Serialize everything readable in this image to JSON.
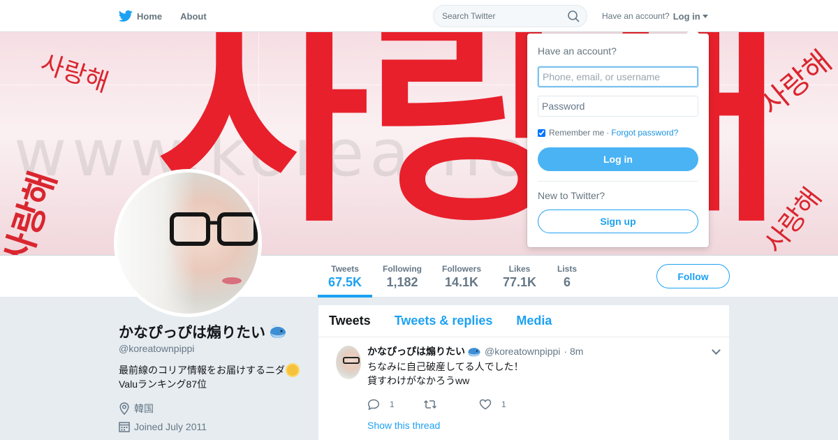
{
  "nav": {
    "home_label": "Home",
    "about_label": "About",
    "search_placeholder": "Search Twitter",
    "have_account": "Have an account?",
    "login_label": "Log in"
  },
  "banner": {
    "main_text": "사랑해",
    "small_text": "사랑해",
    "watermark": "www.korea.net"
  },
  "profile": {
    "name": "かなぴっぴは煽りたい",
    "handle": "@koreatownpippi",
    "bio_line1": "最前線のコリア情報をお届けするニダ",
    "bio_line2": "Valuランキング87位",
    "location": "韓国",
    "joined": "Joined July 2011"
  },
  "stats": [
    {
      "label": "Tweets",
      "value": "67.5K"
    },
    {
      "label": "Following",
      "value": "1,182"
    },
    {
      "label": "Followers",
      "value": "14.1K"
    },
    {
      "label": "Likes",
      "value": "77.1K"
    },
    {
      "label": "Lists",
      "value": "6"
    }
  ],
  "follow_label": "Follow",
  "timeline": {
    "tabs": [
      "Tweets",
      "Tweets & replies",
      "Media"
    ],
    "tweet": {
      "name": "かなぴっぴは煽りたい",
      "handle": "@koreatownpippi",
      "time": "· 8m",
      "line1": "ちなみに自己破産してる人でした！",
      "line2": "貸すわけがなかろうww",
      "reply_count": "1",
      "retweet_count": "",
      "like_count": "1",
      "show_thread": "Show this thread"
    }
  },
  "login_dropdown": {
    "title": "Have an account?",
    "username_placeholder": "Phone, email, or username",
    "password_placeholder": "Password",
    "remember_label": "Remember me",
    "separator": "·",
    "forgot_label": "Forgot password?",
    "login_button": "Log in",
    "new_to": "New to Twitter?",
    "signup_button": "Sign up"
  },
  "colors": {
    "accent": "#1da1f2",
    "login_button": "#4ab3f4",
    "banner_red": "#e8202b"
  }
}
